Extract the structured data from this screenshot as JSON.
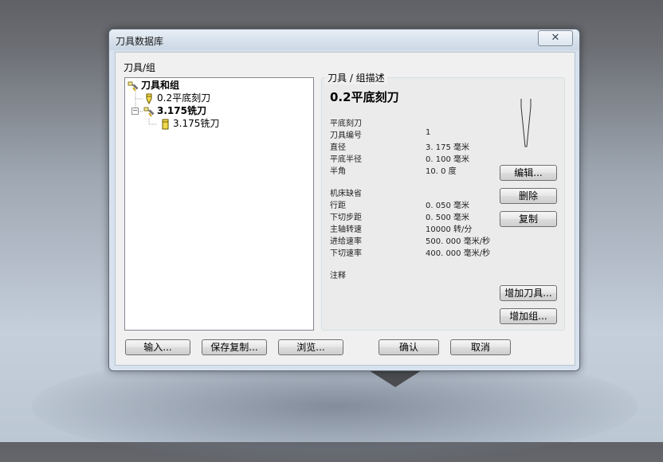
{
  "window": {
    "title": "刀具数据库",
    "close_glyph": "✕"
  },
  "tree": {
    "label": "刀具/组",
    "nodes": [
      {
        "label": "刀具和组",
        "bold": true,
        "icon": "tool-group-icon"
      },
      {
        "label": "0.2平底刻刀",
        "bold": false,
        "icon": "engraving-tool-icon"
      },
      {
        "label": "3.175铣刀",
        "bold": true,
        "icon": "tool-group-icon"
      },
      {
        "label": "3.175铣刀",
        "bold": false,
        "icon": "end-mill-icon"
      }
    ]
  },
  "description": {
    "legend": "刀具 / 组描述",
    "tool_name": "0.2平底刻刀",
    "section1_title": "平底刻刀",
    "section1": [
      {
        "key": "刀具编号",
        "value": "1"
      },
      {
        "key": "直径",
        "value": "3. 175  毫米"
      },
      {
        "key": "平底半径",
        "value": "0. 100  毫米"
      },
      {
        "key": "半角",
        "value": "10. 0  度"
      }
    ],
    "section2_title": "机床缺省",
    "section2": [
      {
        "key": "行距",
        "value": "0. 050  毫米"
      },
      {
        "key": "下切步距",
        "value": "0. 500  毫米"
      },
      {
        "key": "主轴转速",
        "value": "10000  转/分"
      },
      {
        "key": "进给速率",
        "value": "500. 000  毫米/秒"
      },
      {
        "key": "下切速率",
        "value": "400. 000  毫米/秒"
      }
    ],
    "notes_label": "注释"
  },
  "side_buttons": {
    "edit": "编辑...",
    "delete": "删除",
    "copy": "复制",
    "add_tool": "增加刀具...",
    "add_group": "增加组..."
  },
  "bottom_buttons": {
    "import": "输入...",
    "save_copy": "保存复制...",
    "browse": "浏览...",
    "ok": "确认",
    "cancel": "取消"
  }
}
